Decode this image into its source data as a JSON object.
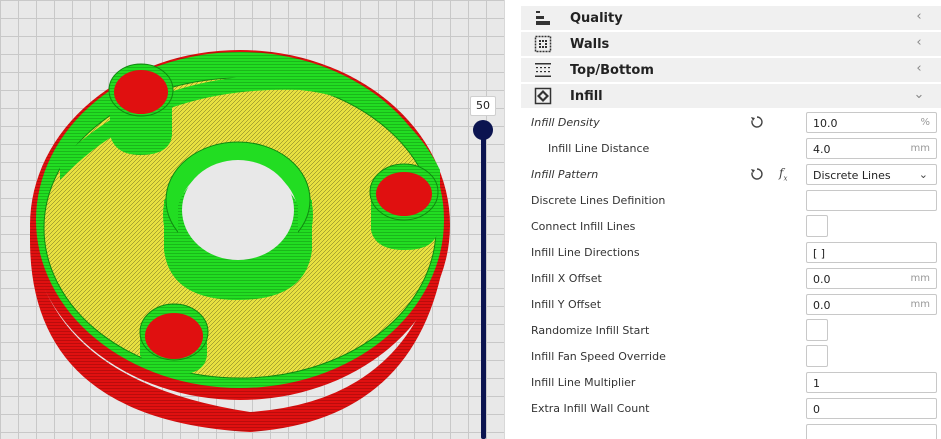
{
  "viewport": {
    "layer_value": "50"
  },
  "categories": [
    {
      "label": "Quality",
      "icon": "quality-icon",
      "expanded": false
    },
    {
      "label": "Walls",
      "icon": "walls-icon",
      "expanded": false
    },
    {
      "label": "Top/Bottom",
      "icon": "top-bottom-icon",
      "expanded": false
    },
    {
      "label": "Infill",
      "icon": "infill-icon",
      "expanded": true
    }
  ],
  "settings": {
    "infill_density": {
      "label": "Infill Density",
      "value": "10.0",
      "unit": "%"
    },
    "infill_line_distance": {
      "label": "Infill Line Distance",
      "value": "4.0",
      "unit": "mm"
    },
    "infill_pattern": {
      "label": "Infill Pattern",
      "value": "Discrete Lines"
    },
    "discrete_lines_definition": {
      "label": "Discrete Lines Definition",
      "value": ""
    },
    "connect_infill_lines": {
      "label": "Connect Infill Lines"
    },
    "infill_line_directions": {
      "label": "Infill Line Directions",
      "value": "[ ]"
    },
    "infill_x_offset": {
      "label": "Infill X Offset",
      "value": "0.0",
      "unit": "mm"
    },
    "infill_y_offset": {
      "label": "Infill Y Offset",
      "value": "0.0",
      "unit": "mm"
    },
    "randomize_infill_start": {
      "label": "Randomize Infill Start"
    },
    "infill_fan_speed_override": {
      "label": "Infill Fan Speed Override"
    },
    "infill_line_multiplier": {
      "label": "Infill Line Multiplier",
      "value": "1"
    },
    "extra_infill_wall_count": {
      "label": "Extra Infill Wall Count",
      "value": "0"
    }
  },
  "colors": {
    "outer_wall": "#e01010",
    "inner_wall": "#22dd22",
    "infill": "#e8e040",
    "slider": "#0b1450"
  }
}
